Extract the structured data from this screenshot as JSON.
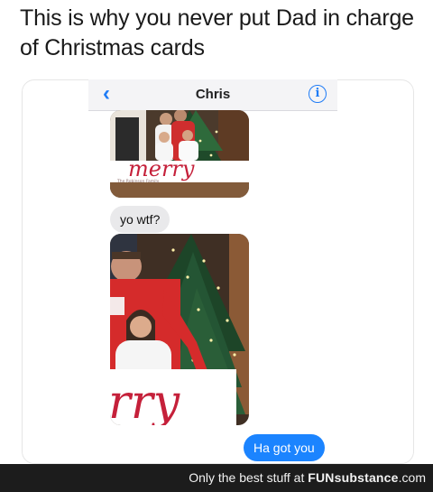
{
  "caption": "This is why you never put Dad in charge of Christmas cards",
  "conversation": {
    "contact_name": "Chris",
    "back_icon": "chevron-left-icon",
    "info_icon": "info-circle-icon",
    "back_glyph": "‹",
    "info_glyph": "i",
    "photo1_card_word": "merry",
    "photo1_card_signature": "The Robinson Family",
    "photo2_card_word": "rry",
    "messages": [
      {
        "from": "contact",
        "text": "yo wtf?"
      },
      {
        "from": "me",
        "text": "Ha got you"
      }
    ],
    "accent_blue": "#1b84ff",
    "bubble_gray": "#e9e9eb"
  },
  "footer": {
    "tagline": "Only the best stuff at",
    "brand": "FUNsubstance",
    "domain": ".com"
  }
}
